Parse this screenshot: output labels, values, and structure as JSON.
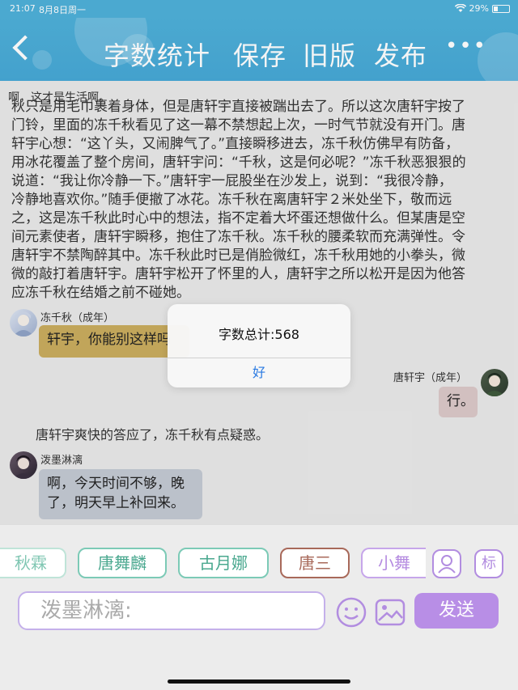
{
  "status": {
    "time": "21:07",
    "date": "8月8日周一",
    "battery": "29%",
    "battery_level": 0.29
  },
  "header": {
    "stats": "字数统计",
    "save": "保存",
    "old": "旧版",
    "publish": "发布",
    "more": "•••"
  },
  "content": {
    "first_line": "啊，这才是生活啊。",
    "paragraph": [
      "秋只是用毛巾裹着身体，但是唐轩宇直接被踹出去了。所以这次唐轩宇按了",
      "门铃，里面的冻千秋看见了这一幕不禁想起上次，一时气节就没有开门。唐",
      "轩宇心想：“这丫头，又闹脾气了。”直接瞬移进去，冻千秋仿佛早有防备，",
      "用冰花覆盖了整个房间，唐轩宇问：“千秋，这是何必呢？”冻千秋恶狠狠的",
      "说道：“我让你冷静一下。”唐轩宇一屁股坐在沙发上，说到：“我很冷静，",
      "冷静地喜欢你。”随手便撤了冰花。冻千秋在离唐轩宇２米处坐下，敬而远",
      "之，这是冻千秋此时心中的想法，指不定着大坏蛋还想做什么。但某唐是空",
      "间元素使者，唐轩宇瞬移，抱住了冻千秋。冻千秋的腰柔软而充满弹性。令",
      "唐轩宇不禁陶醉其中。冻千秋此时已是俏脸微红，冻千秋用她的小拳头，微",
      "微的敲打着唐轩宇。唐轩宇松开了怀里的人，唐轩宇之所以松开是因为他答",
      "应冻千秋在结婚之前不碰她。"
    ],
    "messages": [
      {
        "name": "冻千秋（成年）",
        "text": "轩宇，你能别这样吗"
      },
      {
        "name": "唐轩宇（成年）",
        "text": "行。"
      },
      {
        "narration": "唐轩宇爽快的答应了，冻千秋有点疑惑。"
      },
      {
        "name": "泼墨淋漓",
        "text": "啊，今天时间不够，晚了，明天早上补回来。"
      }
    ]
  },
  "modal": {
    "message": "字数总计:568",
    "ok": "好"
  },
  "panel": {
    "chips": [
      "秋霖",
      "唐舞麟",
      "古月娜",
      "唐三",
      "小舞"
    ],
    "tag_icon_label": "标",
    "input_placeholder": "泼墨淋漓:",
    "send": "发送"
  },
  "colors": {
    "header": "#4fb0d9",
    "send": "#b88ee6",
    "ok_text": "#2a7ae2"
  }
}
